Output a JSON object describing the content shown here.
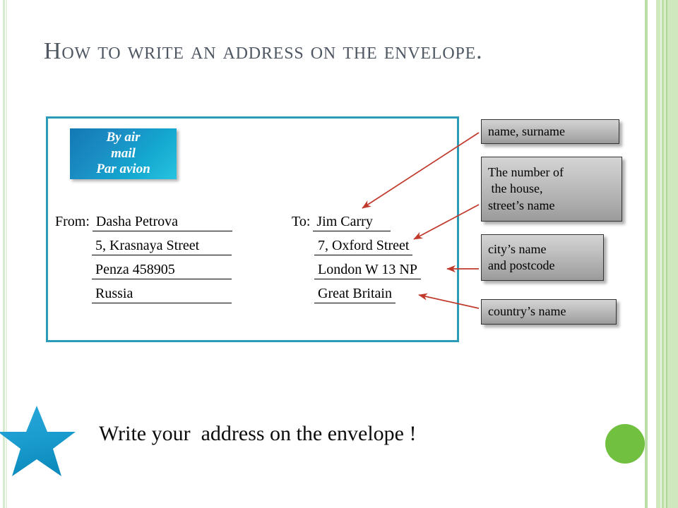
{
  "slide": {
    "title": "How to write an address on the envelope.",
    "bottom_text": "Write your  address on the envelope !",
    "title_color": "#4e5762",
    "envelope_border_color": "#2a9cb8",
    "arrow_color": "#c0392b",
    "star_color": "#1fa0d2",
    "dot_color": "#72c040",
    "stripe_color": "#cfe8bd"
  },
  "envelope": {
    "air_mail_badge": {
      "line1": "By air",
      "line2": "mail",
      "line3": "Par avion"
    },
    "from": {
      "label": "From:",
      "lines": [
        "Dasha Petrova",
        "5, Krasnaya Street",
        "Penza 458905",
        "Russia"
      ]
    },
    "to": {
      "label": "To:",
      "lines": [
        "Jim Carry",
        "7, Oxford Street",
        "London W 13 NP",
        "Great Britain"
      ]
    }
  },
  "callouts": [
    {
      "id": "name",
      "line1": "name, surname",
      "line2": "",
      "line3": ""
    },
    {
      "id": "house",
      "line1": "The number of",
      "line2": " the house,",
      "line3": "street’s name"
    },
    {
      "id": "city",
      "line1": "city’s name",
      "line2": "and postcode",
      "line3": ""
    },
    {
      "id": "country",
      "line1": "country’s name",
      "line2": "",
      "line3": ""
    }
  ]
}
